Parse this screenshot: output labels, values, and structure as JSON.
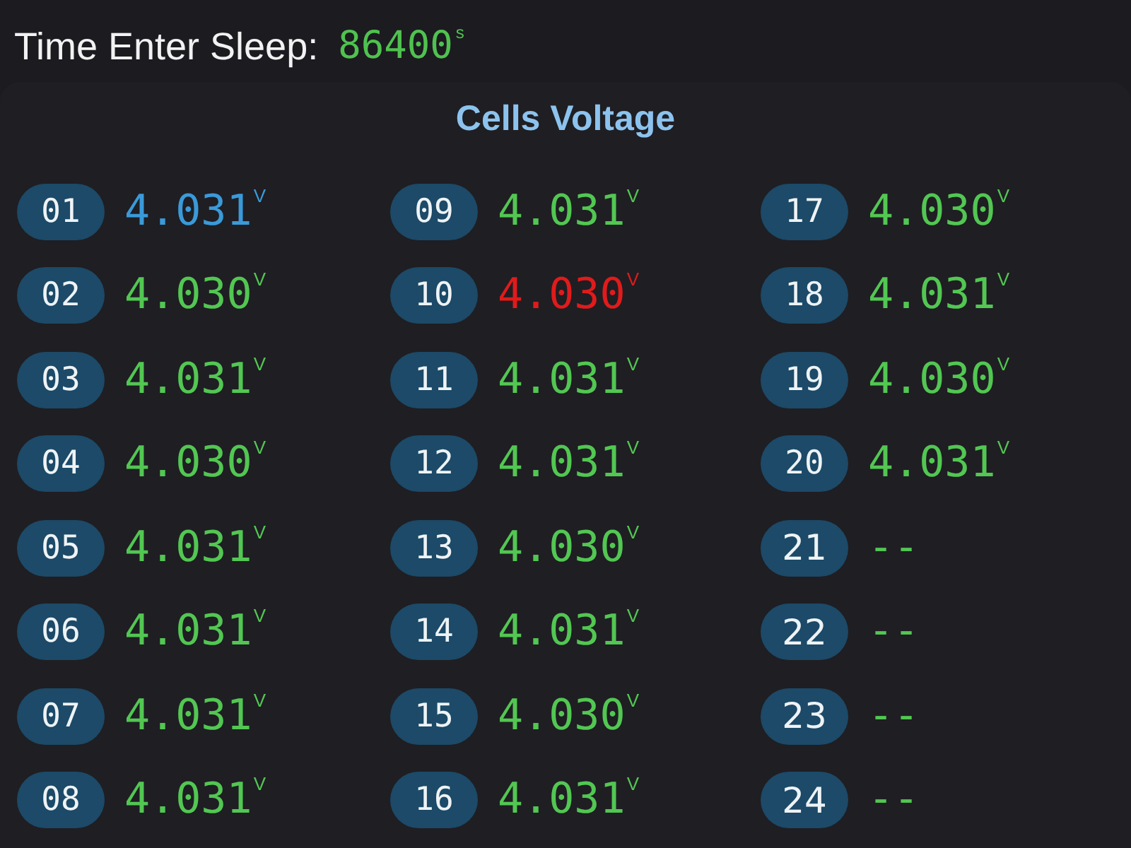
{
  "header": {
    "label": "Time Enter Sleep:",
    "value": "86400$^{s}$"
  },
  "panel": {
    "title": "Cells Voltage",
    "cells": [
      {
        "number": "01",
        "kind": "reading",
        "value": "4.031$^{V}$",
        "color": "#3a9ad9"
      },
      {
        "number": "02",
        "kind": "reading",
        "value": "4.030$^{V}$",
        "color": "#52c752"
      },
      {
        "number": "03",
        "kind": "reading",
        "value": "4.031$^{V}$",
        "color": "#52c752"
      },
      {
        "number": "04",
        "kind": "reading",
        "value": "4.030$^{V}$",
        "color": "#52c752"
      },
      {
        "number": "05",
        "kind": "reading",
        "value": "4.031$^{V}$",
        "color": "#52c752"
      },
      {
        "number": "06",
        "kind": "reading",
        "value": "4.031$^{V}$",
        "color": "#52c752"
      },
      {
        "number": "07",
        "kind": "reading",
        "value": "4.031$^{V}$",
        "color": "#52c752"
      },
      {
        "number": "08",
        "kind": "reading",
        "value": "4.031$^{V}$",
        "color": "#52c752"
      },
      {
        "number": "09",
        "kind": "reading",
        "value": "4.031$^{V}$",
        "color": "#52c752"
      },
      {
        "number": "10",
        "kind": "reading",
        "value": "4.030$^{V}$",
        "color": "#e01b1b"
      },
      {
        "number": "11",
        "kind": "reading",
        "value": "4.031$^{V}$",
        "color": "#52c752"
      },
      {
        "number": "12",
        "kind": "reading",
        "value": "4.031$^{V}$",
        "color": "#52c752"
      },
      {
        "number": "13",
        "kind": "reading",
        "value": "4.030$^{V}$",
        "color": "#52c752"
      },
      {
        "number": "14",
        "kind": "reading",
        "value": "4.031$^{V}$",
        "color": "#52c752"
      },
      {
        "number": "15",
        "kind": "reading",
        "value": "4.030$^{V}$",
        "color": "#52c752"
      },
      {
        "number": "16",
        "kind": "reading",
        "value": "4.031$^{V}$",
        "color": "#52c752"
      },
      {
        "number": "17",
        "kind": "reading",
        "value": "4.030$^{V}$",
        "color": "#52c752"
      },
      {
        "number": "18",
        "kind": "reading",
        "value": "4.031$^{V}$",
        "color": "#52c752"
      },
      {
        "number": "19",
        "kind": "reading",
        "value": "4.030$^{V}$",
        "color": "#52c752"
      },
      {
        "number": "20",
        "kind": "reading",
        "value": "4.031$^{V}$",
        "color": "#52c752"
      },
      {
        "number": "21",
        "kind": "empty",
        "value": "--",
        "color": "#52c752"
      },
      {
        "number": "22",
        "kind": "empty",
        "value": "--",
        "color": "#52c752"
      },
      {
        "number": "23",
        "kind": "empty",
        "value": "--",
        "color": "#52c752"
      },
      {
        "number": "24",
        "kind": "empty",
        "value": "--",
        "color": "#52c752"
      }
    ]
  }
}
